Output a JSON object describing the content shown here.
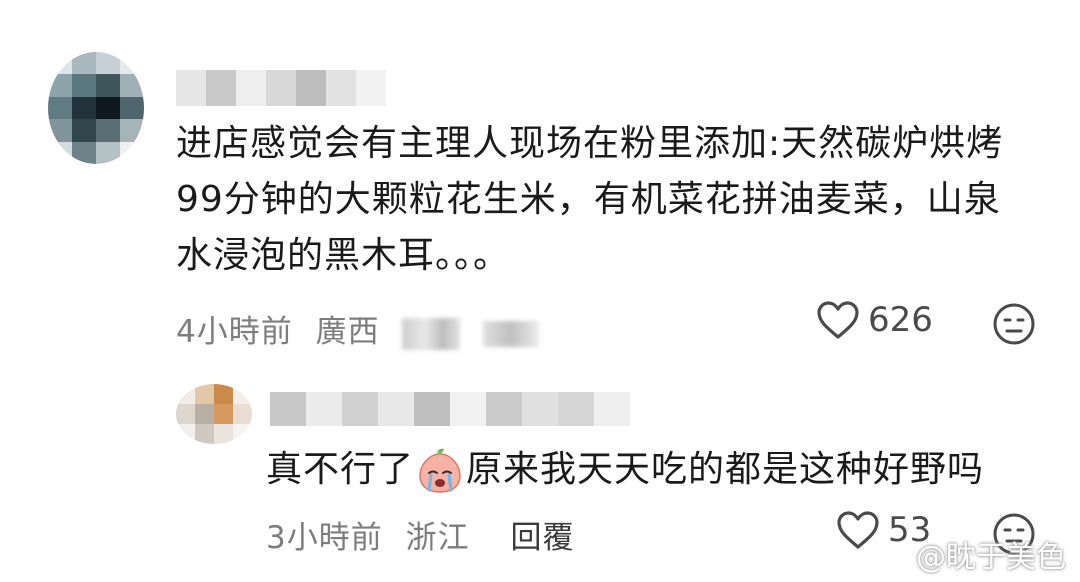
{
  "comment1": {
    "text": "进店感觉会有主理人现场在粉里添加:天然碳炉烘烤\n99分钟的大颗粒花生米，有机菜花拼油麦菜，山泉\n水浸泡的黑木耳。。。",
    "time": "4小時前",
    "location": "廣西",
    "like_count": "626"
  },
  "comment2": {
    "text_before": "真不行了",
    "text_after": "原来我天天吃的都是这种好野吗",
    "time": "3小時前",
    "location": "浙江",
    "reply_label": "回覆",
    "like_count": "53"
  },
  "watermark": {
    "text": "@眈于美色"
  },
  "icons": {
    "like": "heart-outline-icon",
    "reaction": "neutral-face-icon",
    "emoji": "crying-peach-emoji",
    "watermark": "weibo-logo-icon"
  }
}
